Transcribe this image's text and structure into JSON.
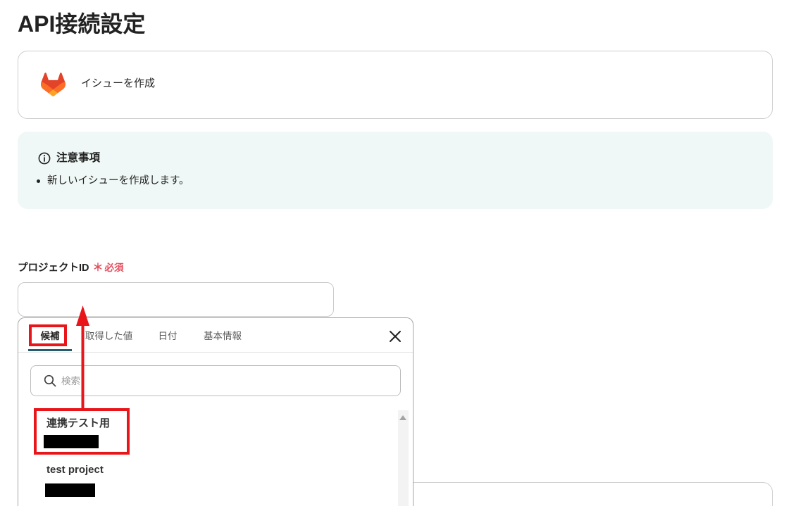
{
  "page": {
    "title": "API接続設定"
  },
  "action_card": {
    "app_icon": "gitlab-logo-icon",
    "label": "イシューを作成"
  },
  "notice": {
    "icon": "info-icon",
    "title": "注意事項",
    "items": [
      "新しいイシューを作成します。"
    ]
  },
  "project_id_field": {
    "label": "プロジェクトID",
    "required_mark": "＊",
    "required_text": "必須",
    "value": ""
  },
  "picker": {
    "tabs": [
      {
        "label": "候補",
        "active": true
      },
      {
        "label": "取得した値",
        "active": false
      },
      {
        "label": "日付",
        "active": false
      },
      {
        "label": "基本情報",
        "active": false
      }
    ],
    "close_icon": "close-icon",
    "search": {
      "icon": "search-icon",
      "placeholder": "検索",
      "value": ""
    },
    "options": [
      {
        "name": "連携テスト用",
        "id_redacted": true
      },
      {
        "name": "test project",
        "id_redacted": true
      }
    ],
    "scroll_icon": "scroll-up-arrow-icon"
  },
  "colors": {
    "text": "#222222",
    "border": "#cdcdcd",
    "required": "#e5505f",
    "notice_background": "#eff8f6",
    "active_tab_underline": "#285b6c",
    "annotation_red": "#e8161b"
  }
}
